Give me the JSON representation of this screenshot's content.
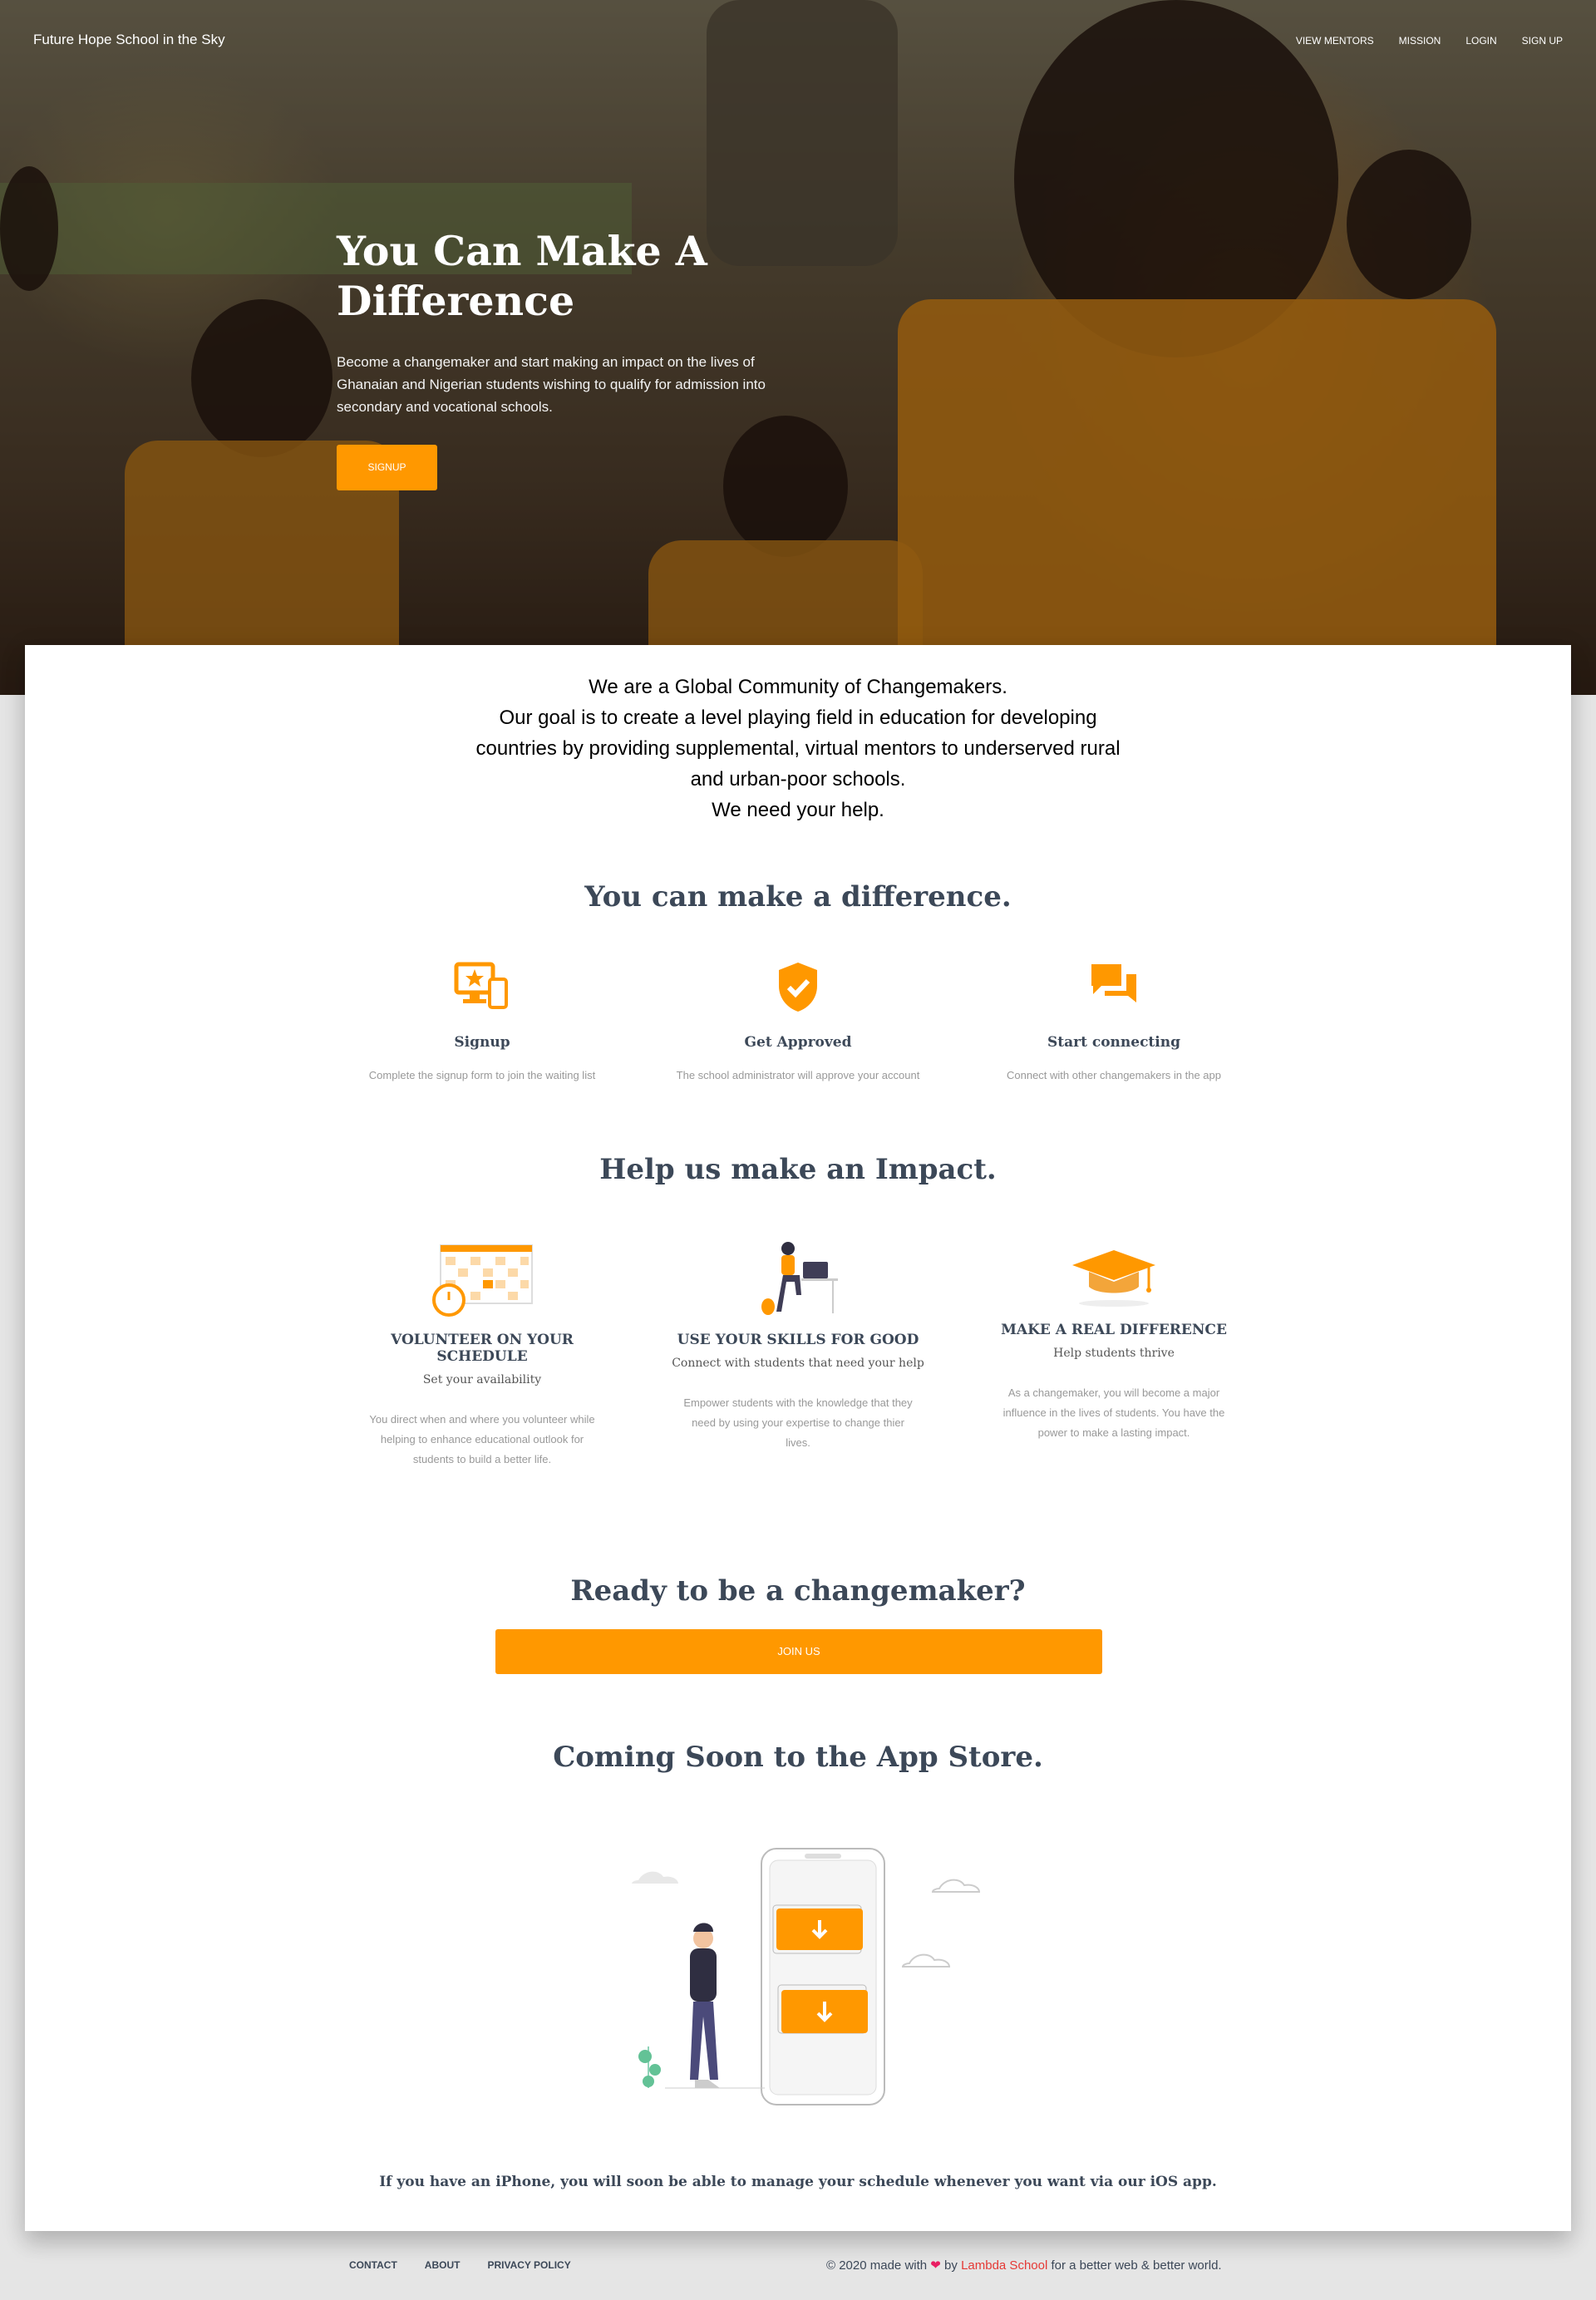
{
  "navbar": {
    "brand": "Future Hope School in the Sky",
    "links": [
      "VIEW MENTORS",
      "MISSION",
      "LOGIN",
      "SIGN UP"
    ]
  },
  "hero": {
    "title": "You Can Make A Difference",
    "description": "Become a changemaker and start making an impact on the lives of Ghanaian and Nigerian students wishing to qualify for admission into secondary and vocational schools.",
    "button": "SIGNUP"
  },
  "intro": {
    "lines": [
      "We are a Global Community of Changemakers.",
      "Our goal is to create a level playing field in education for developing countries by providing supplemental, virtual mentors to underserved rural and urban-poor schools.",
      "We need your help."
    ]
  },
  "features": {
    "title": "You can make a difference.",
    "items": [
      {
        "icon": "computer-star-icon",
        "name": "Signup",
        "desc": "Complete the signup form to join the waiting list"
      },
      {
        "icon": "verified-shield-icon",
        "name": "Get Approved",
        "desc": "The school administrator will approve your account"
      },
      {
        "icon": "chat-bubbles-icon",
        "name": "Start connecting",
        "desc": "Connect with other changemakers in the app"
      }
    ]
  },
  "impact": {
    "title": "Help us make an Impact.",
    "items": [
      {
        "name": "VOLUNTEER ON YOUR SCHEDULE",
        "sub": "Set your availability",
        "desc": "You direct when and where you volunteer while helping to enhance educational outlook for students to build a better life."
      },
      {
        "name": "USE YOUR SKILLS FOR GOOD",
        "sub": "Connect with students that need your help",
        "desc": "Empower students with the knowledge that they need by using your expertise to change thier lives."
      },
      {
        "name": "MAKE A REAL DIFFERENCE",
        "sub": "Help students thrive",
        "desc": "As a changemaker, you will become a major influence in the lives of students. You have the power to make a lasting impact."
      }
    ]
  },
  "cta": {
    "title": "Ready to be a changemaker?",
    "button": "JOIN US"
  },
  "app": {
    "title": "Coming Soon to the App Store.",
    "caption": "If you have an iPhone, you will soon be able to manage your schedule whenever you want via our iOS app."
  },
  "footer": {
    "links": [
      "CONTACT",
      "ABOUT",
      "PRIVACY POLICY"
    ],
    "copy_prefix": "© 2020 made with",
    "copy_by": "by",
    "copy_link": "Lambda School",
    "copy_suffix": "for a better web & better world."
  },
  "colors": {
    "accent": "#ff9800",
    "title": "#3c4858",
    "muted": "#999999"
  }
}
